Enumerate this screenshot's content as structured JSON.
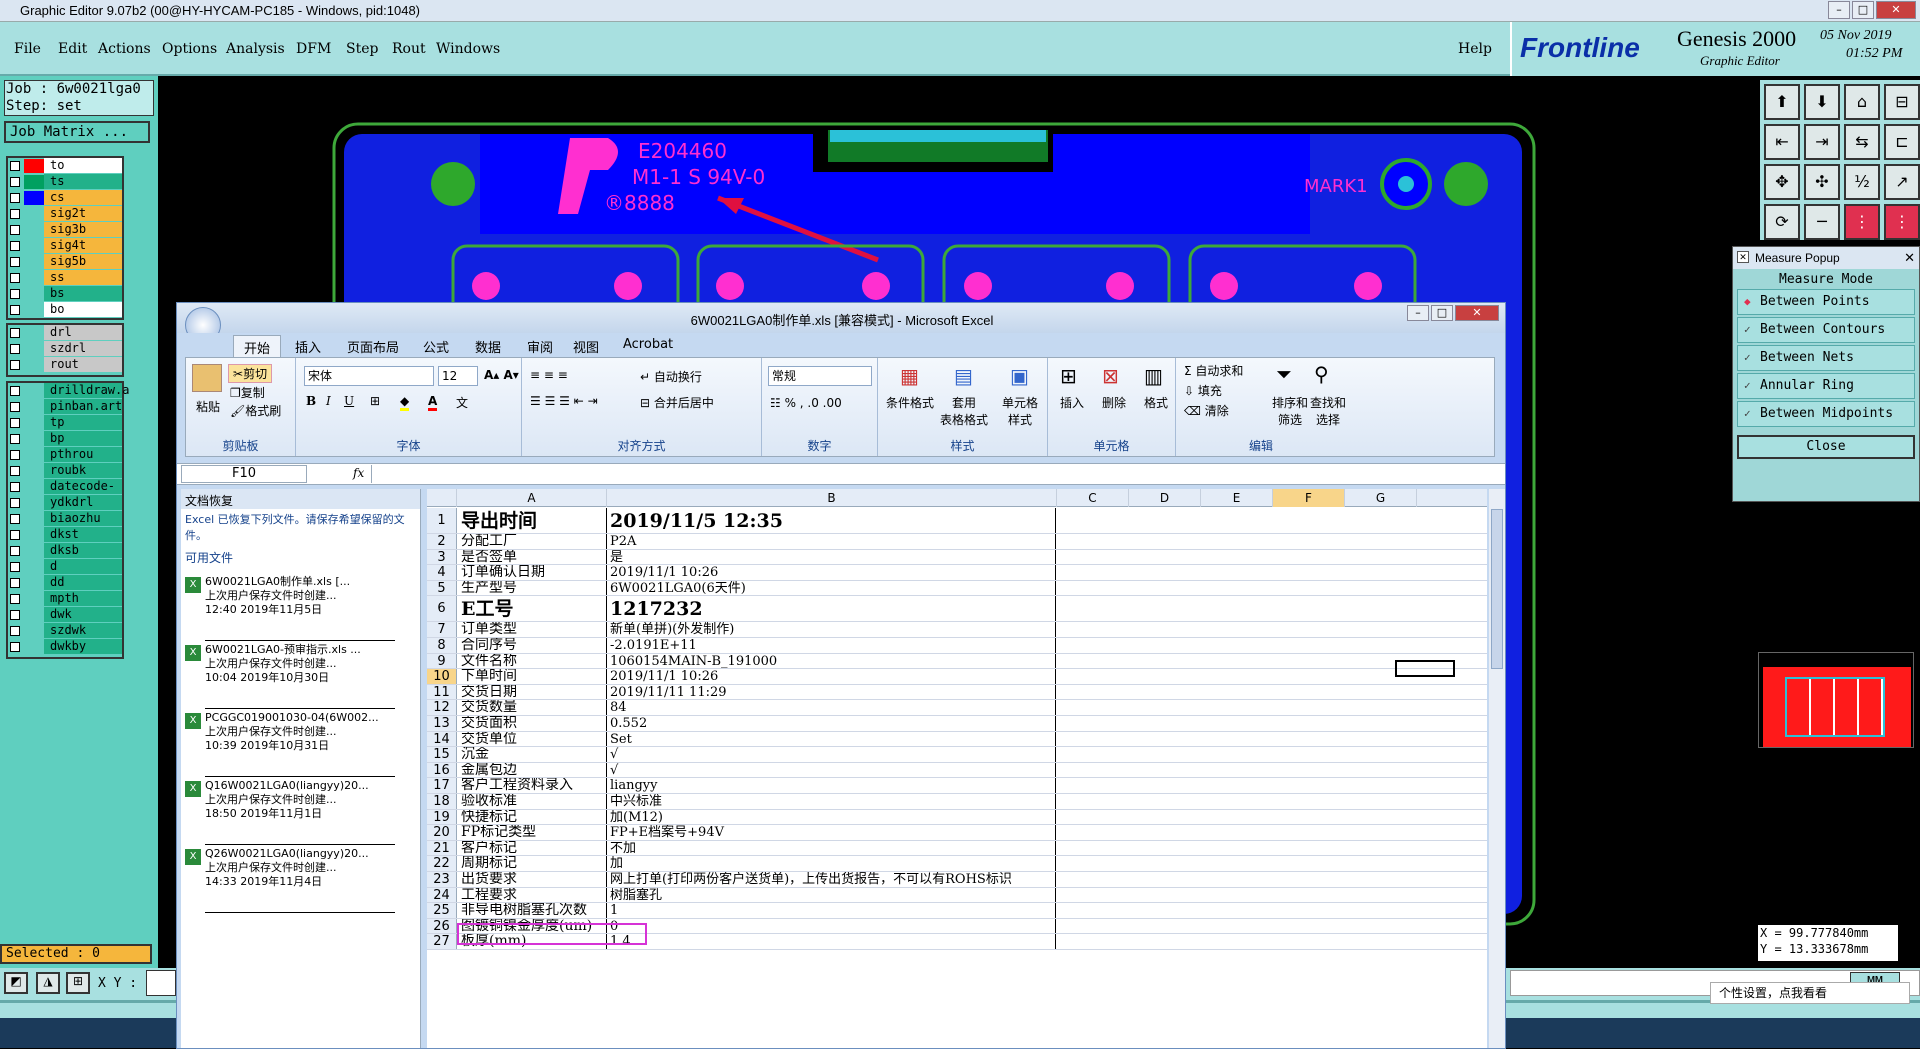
{
  "genesis": {
    "title": "Graphic Editor 9.07b2 (00@HY-HYCAM-PC185 - Windows, pid:1048)",
    "menu": [
      "File",
      "Edit",
      "Actions",
      "Options",
      "Analysis",
      "DFM",
      "Step",
      "Rout",
      "Windows"
    ],
    "help": "Help",
    "brand": "Frontline",
    "product": "Genesis 2000",
    "product_sub": "Graphic Editor",
    "date": "05 Nov 2019",
    "time": "01:52 PM",
    "job": "Job : 6w0021lga0",
    "step": "Step: set",
    "job_matrix": "Job Matrix ...",
    "layers_board": [
      {
        "name": "to",
        "color": "#ff0000",
        "bg": "#ffffff"
      },
      {
        "name": "ts",
        "color": "#00a060",
        "bg": "#22b18a"
      },
      {
        "name": "cs",
        "color": "#0000ff",
        "bg": "#f5b63c"
      },
      {
        "name": "sig2t",
        "color": "",
        "bg": "#f5b63c"
      },
      {
        "name": "sig3b",
        "color": "",
        "bg": "#f5b63c"
      },
      {
        "name": "sig4t",
        "color": "",
        "bg": "#f5b63c"
      },
      {
        "name": "sig5b",
        "color": "",
        "bg": "#f5b63c"
      },
      {
        "name": "ss",
        "color": "",
        "bg": "#f5b63c"
      },
      {
        "name": "bs",
        "color": "",
        "bg": "#22b18a"
      },
      {
        "name": "bo",
        "color": "",
        "bg": "#ffffff"
      }
    ],
    "layers_drill": [
      {
        "name": "drl",
        "bg": "#c8c8c8"
      },
      {
        "name": "szdrl",
        "bg": "#c8c8c8"
      },
      {
        "name": "rout",
        "bg": "#c8c8c8"
      }
    ],
    "layers_misc": [
      "drilldraw.a",
      "pinban.art",
      "tp",
      "bp",
      "pthrou",
      "roubk",
      "datecode-pt",
      "ydkdrl",
      "biaozhu",
      "dkst",
      "dksb",
      "d",
      "dd",
      "mpth",
      "dwk",
      "szdwk",
      "dwkby"
    ],
    "selected": "Selected : 0",
    "xy_label": "X Y :",
    "units": "MM",
    "coord_x": "X = 99.777840mm",
    "coord_y": "Y = 13.333678mm",
    "measure": {
      "title": "Measure Popup",
      "mode": "Measure Mode",
      "options": [
        "Between Points",
        "Between Contours",
        "Between Nets",
        "Annular Ring",
        "Between Midpoints"
      ],
      "close": "Close"
    },
    "canvas_text": {
      "ul": "E204460",
      "rating": "M1-1 S 94V-0",
      "code": "®8888",
      "mark": "MARK1"
    },
    "ime_tip": "个性设置，点我看看"
  },
  "excel": {
    "title": "6W0021LGA0制作单.xls  [兼容模式] - Microsoft Excel",
    "tabs": [
      "开始",
      "插入",
      "页面布局",
      "公式",
      "数据",
      "审阅",
      "视图",
      "Acrobat"
    ],
    "groups": [
      "剪贴板",
      "字体",
      "对齐方式",
      "数字",
      "样式",
      "单元格",
      "编辑"
    ],
    "clip": {
      "paste": "粘贴",
      "cut": "剪切",
      "copy": "复制",
      "format": "格式刷"
    },
    "font_name": "宋体",
    "font_size": "12",
    "align": {
      "wrap": "自动换行",
      "merge": "合并后居中"
    },
    "number_format": "常规",
    "styles": [
      "条件格式",
      "套用\n表格格式",
      "单元格\n样式"
    ],
    "cells": [
      "插入",
      "删除",
      "格式"
    ],
    "edit": {
      "autosum": "自动求和",
      "fill": "填充",
      "clear": "清除",
      "sort": "排序和\n筛选",
      "find": "查找和\n选择"
    },
    "name_box": "F10",
    "recovery": {
      "title": "文档恢复",
      "desc": "Excel 已恢复下列文件。请保存希望保留的文件。",
      "avail": "可用文件",
      "files": [
        {
          "name": "6W0021LGA0制作单.xls  [...",
          "note": "上次用户保存文件时创建...",
          "time": "12:40 2019年11月5日"
        },
        {
          "name": "6W0021LGA0-预审指示.xls ...",
          "note": "上次用户保存文件时创建...",
          "time": "10:04 2019年10月30日"
        },
        {
          "name": "PCGGC019001030-04(6W002...",
          "note": "上次用户保存文件时创建...",
          "time": "10:39 2019年10月31日"
        },
        {
          "name": "Q16W0021LGA0(liangyy)20...",
          "note": "上次用户保存文件时创建...",
          "time": "18:50 2019年11月1日"
        },
        {
          "name": "Q26W0021LGA0(liangyy)20...",
          "note": "上次用户保存文件时创建...",
          "time": "14:33 2019年11月4日"
        }
      ]
    },
    "columns": [
      "A",
      "B",
      "C",
      "D",
      "E",
      "F",
      "G"
    ],
    "rows": [
      {
        "n": "1",
        "a": "导出时间",
        "b": "2019/11/5 12:35",
        "big": true
      },
      {
        "n": "2",
        "a": "分配工厂",
        "b": "P2A"
      },
      {
        "n": "3",
        "a": "是否签单",
        "b": "是"
      },
      {
        "n": "4",
        "a": "订单确认日期",
        "b": "2019/11/1 10:26"
      },
      {
        "n": "5",
        "a": "生产型号",
        "b": "6W0021LGA0(6天件)"
      },
      {
        "n": "6",
        "a": "E工号",
        "b": "1217232",
        "big": true
      },
      {
        "n": "7",
        "a": "订单类型",
        "b": "新单(单拼)(外发制作)"
      },
      {
        "n": "8",
        "a": "合同序号",
        "b": "-2.0191E+11"
      },
      {
        "n": "9",
        "a": "文件名称",
        "b": "1060154MAIN-B_191000"
      },
      {
        "n": "10",
        "a": "下单时间",
        "b": "2019/11/1 10:26"
      },
      {
        "n": "11",
        "a": "交货日期",
        "b": "2019/11/11 11:29"
      },
      {
        "n": "12",
        "a": "交货数量",
        "b": "84"
      },
      {
        "n": "13",
        "a": "交货面积",
        "b": "0.552"
      },
      {
        "n": "14",
        "a": "交货单位",
        "b": "Set"
      },
      {
        "n": "15",
        "a": "沉金",
        "b": "√"
      },
      {
        "n": "16",
        "a": "金属包边",
        "b": "√"
      },
      {
        "n": "17",
        "a": "客户工程资料录入",
        "b": "liangyy"
      },
      {
        "n": "18",
        "a": "验收标准",
        "b": "中兴标准"
      },
      {
        "n": "19",
        "a": "快捷标记",
        "b": "加(M12)"
      },
      {
        "n": "20",
        "a": "FP标记类型",
        "b": "FP+E档案号+94V"
      },
      {
        "n": "21",
        "a": "客户标记",
        "b": "不加"
      },
      {
        "n": "22",
        "a": "周期标记",
        "b": "加"
      },
      {
        "n": "23",
        "a": "出货要求",
        "b": "网上打单(打印两份客户送货单)，上传出货报告，不可以有ROHS标识"
      },
      {
        "n": "24",
        "a": "工程要求",
        "b": "树脂塞孔"
      },
      {
        "n": "25",
        "a": "非导电树脂塞孔次数",
        "b": "1"
      },
      {
        "n": "26",
        "a": "图镀铜镍金厚度(um)",
        "b": "0"
      },
      {
        "n": "27",
        "a": "板厚(mm)",
        "b": "1.4"
      }
    ],
    "highlight_color": "#d633d6"
  }
}
